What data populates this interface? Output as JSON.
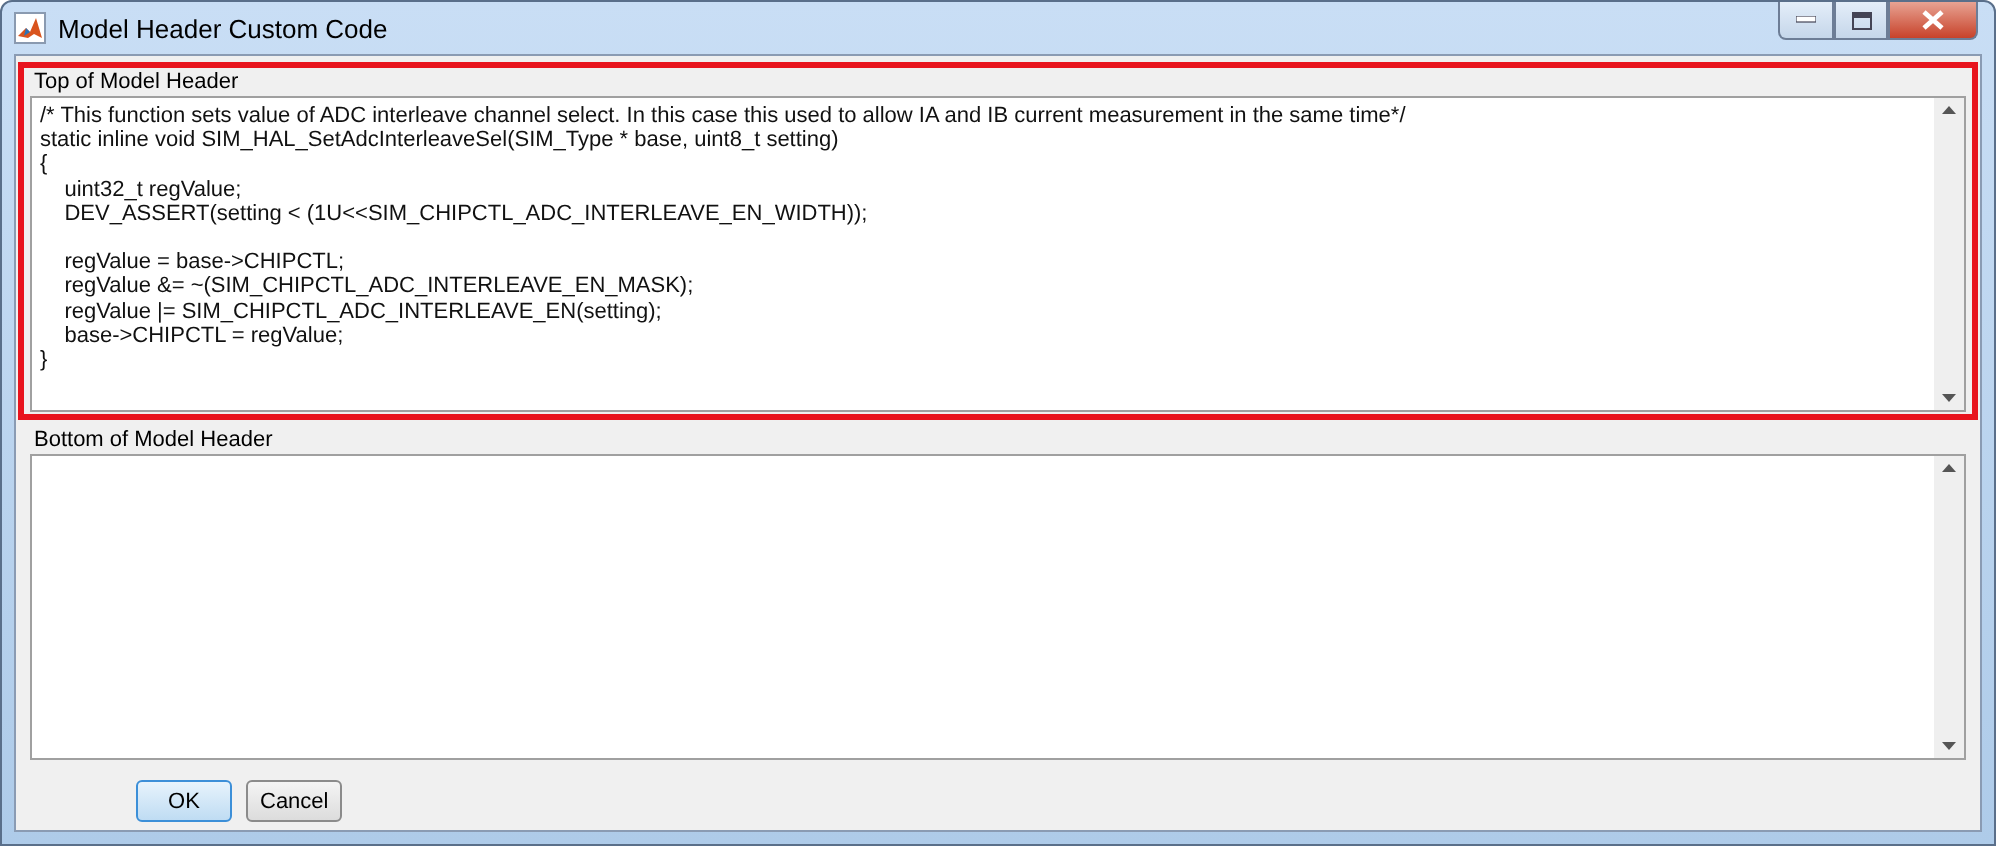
{
  "window": {
    "title": "Model Header Custom Code"
  },
  "top_section": {
    "label": "Top of Model Header",
    "highlighted": true,
    "code": "/* This function sets value of ADC interleave channel select. In this case this used to allow IA and IB current measurement in the same time*/\nstatic inline void SIM_HAL_SetAdcInterleaveSel(SIM_Type * base, uint8_t setting)\n{\n    uint32_t regValue;\n    DEV_ASSERT(setting < (1U<<SIM_CHIPCTL_ADC_INTERLEAVE_EN_WIDTH));\n\n    regValue = base->CHIPCTL;\n    regValue &= ~(SIM_CHIPCTL_ADC_INTERLEAVE_EN_MASK);\n    regValue |= SIM_CHIPCTL_ADC_INTERLEAVE_EN(setting);\n    base->CHIPCTL = regValue;\n}"
  },
  "bottom_section": {
    "label": "Bottom of Model Header",
    "highlighted": false
  },
  "buttons": [
    {
      "label": "OK",
      "default": true
    },
    {
      "label": "Cancel",
      "default": false
    }
  ]
}
